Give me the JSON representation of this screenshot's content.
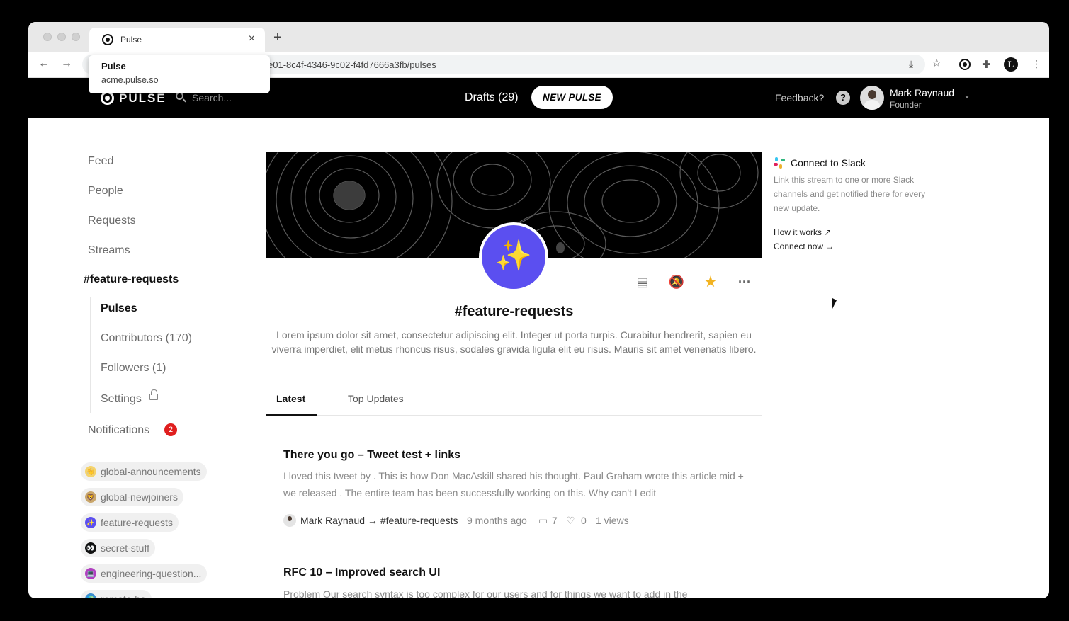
{
  "browser": {
    "tab_title": "Pulse",
    "new_tab": "+",
    "close": "×",
    "url": "e01-8c4f-4346-9c02-f4fd7666a3fb/pulses",
    "hover_title": "Pulse",
    "hover_domain": "acme.pulse.so"
  },
  "header": {
    "logo": "PULSE",
    "search_placeholder": "Search...",
    "drafts": "Drafts (29)",
    "new_pulse": "NEW PULSE",
    "feedback": "Feedback?",
    "help": "?",
    "user_name": "Mark Raynaud",
    "user_role": "Founder"
  },
  "sidebar": {
    "links": [
      "Feed",
      "People",
      "Requests",
      "Streams"
    ],
    "stream": "#feature-requests",
    "sub": [
      "Pulses",
      "Contributors (170)",
      "Followers (1)",
      "Settings"
    ],
    "notifications": "Notifications",
    "notif_count": "2",
    "channels": [
      {
        "name": "global-announcements",
        "icon": "👋",
        "color": "#f5d36b"
      },
      {
        "name": "global-newjoiners",
        "icon": "🦁",
        "color": "#c9a66b"
      },
      {
        "name": "feature-requests",
        "icon": "✨",
        "color": "#5b4ff0"
      },
      {
        "name": "secret-stuff",
        "icon": "👀",
        "color": "#111111"
      },
      {
        "name": "engineering-question...",
        "icon": "💻",
        "color": "#b040c0"
      },
      {
        "name": "remote-ha",
        "icon": "🌍",
        "color": "#3a8fd0"
      }
    ]
  },
  "stream": {
    "title": "#feature-requests",
    "description": "Lorem ipsum dolor sit amet, consectetur adipiscing elit. Integer ut porta turpis. Curabitur hendrerit, sapien eu viverra imperdiet, elit metus rhoncus risus, sodales gravida ligula elit eu risus. Mauris sit amet venenatis libero.",
    "tabs": [
      "Latest",
      "Top Updates"
    ]
  },
  "posts": [
    {
      "title": "There you go – Tweet test + links",
      "excerpt": "I loved this tweet by . This is how Don MacAskill shared his thought. Paul Graham wrote this article mid + we released . The entire team has been successfully working on this. Why can't I edit",
      "author": "Mark Raynaud → #feature-requests",
      "time": "9 months ago",
      "comments": "7",
      "likes": "0",
      "views": "1 views"
    },
    {
      "title": "RFC 10 – Improved search UI",
      "excerpt": "Problem Our search syntax is too complex for our users and for things we want to add in the"
    }
  ],
  "slack": {
    "title": "Connect to Slack",
    "description": "Link this stream to one or more Slack channels and get notified there for every new update.",
    "how": "How it works ↗",
    "connect": "Connect now →"
  }
}
